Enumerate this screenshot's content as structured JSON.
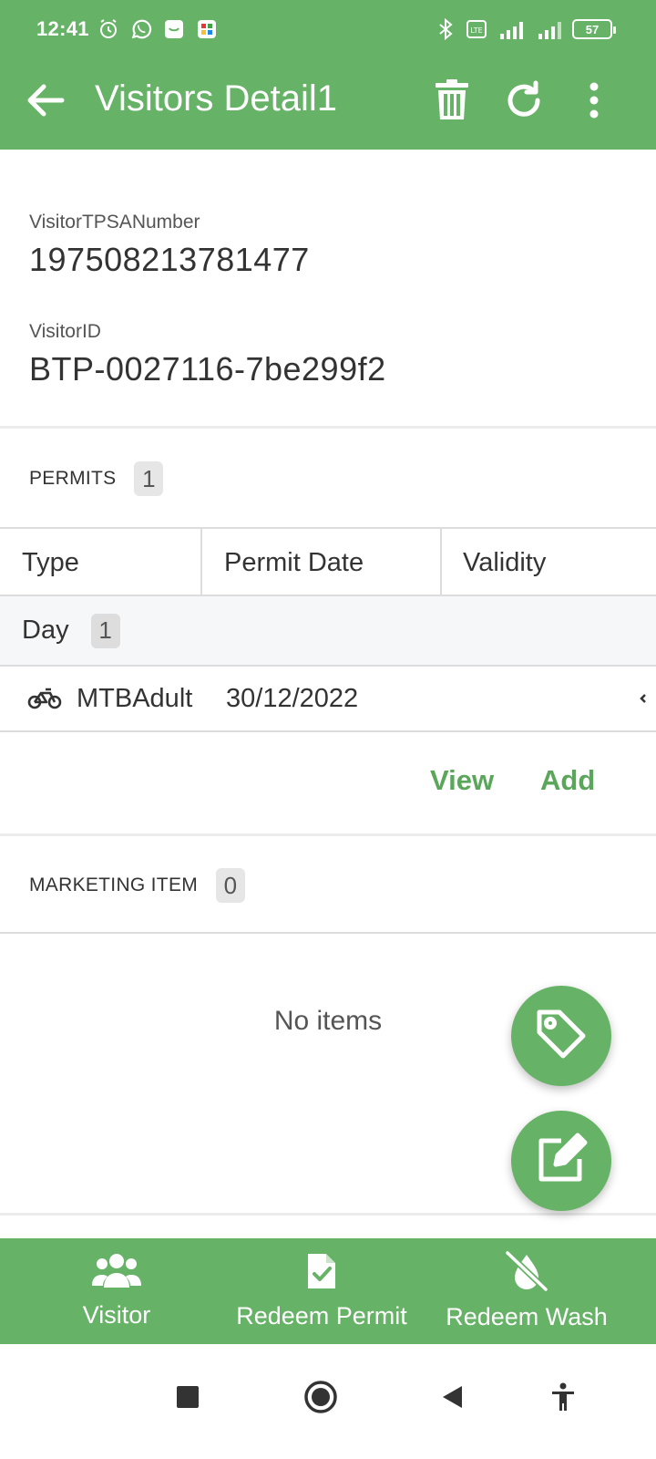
{
  "status_bar": {
    "time": "12:41",
    "battery": "57",
    "icons_left": [
      "alarm-icon",
      "whatsapp-icon",
      "shopping-icon",
      "app-icon"
    ],
    "icons_right": [
      "bluetooth-icon",
      "volte-icon",
      "signal-icon",
      "signal-icon",
      "battery-icon"
    ]
  },
  "toolbar": {
    "title": "Visitors Detail1",
    "back_icon": "arrow-left-icon",
    "actions": [
      "trash-icon",
      "refresh-icon",
      "more-vert-icon"
    ],
    "accent_color": "#66b266"
  },
  "visitor": {
    "tpsa_label": "VisitorTPSANumber",
    "tpsa_value": "197508213781477",
    "id_label": "VisitorID",
    "id_value": "BTP-0027116-7be299f2"
  },
  "permits": {
    "title": "PERMITS",
    "count": "1",
    "columns": [
      "Type",
      "Permit Date",
      "Validity"
    ],
    "groups": [
      {
        "name": "Day",
        "count": "1",
        "rows": [
          {
            "icon": "bicycle-icon",
            "type": "MTBAdult",
            "permit_date": "30/12/2022"
          }
        ]
      }
    ],
    "view_label": "View",
    "add_label": "Add"
  },
  "marketing": {
    "title": "MARKETING ITEM",
    "count": "0",
    "empty_text": "No items"
  },
  "fabs": [
    "tag-icon",
    "edit-icon"
  ],
  "bottom_nav": [
    {
      "label": "Visitor",
      "icon": "users-icon"
    },
    {
      "label": "Redeem Permit",
      "icon": "file-check-icon"
    },
    {
      "label": "Redeem Wash",
      "icon": "no-water-icon"
    }
  ],
  "system_nav": [
    "square-icon",
    "home-circle-icon",
    "back-triangle-icon",
    "accessibility-icon"
  ]
}
